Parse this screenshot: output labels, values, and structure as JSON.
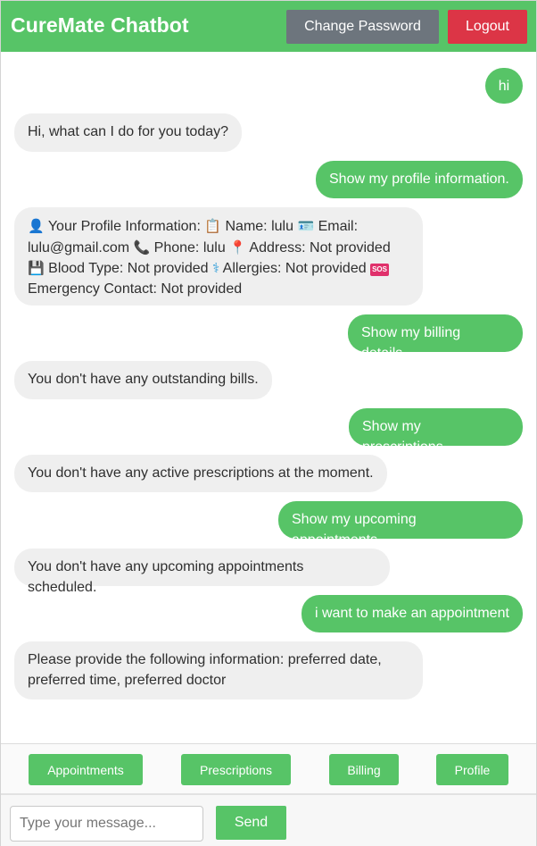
{
  "app": {
    "title": "CureMate Chatbot",
    "change_password_label": "Change Password",
    "logout_label": "Logout"
  },
  "messages": [
    {
      "role": "user",
      "text": "hi"
    },
    {
      "role": "bot",
      "text": "Hi, what can I do for you today?"
    },
    {
      "role": "user",
      "text": "Show my profile information."
    },
    {
      "role": "bot",
      "profile": {
        "line1_a": "Your Profile Information:",
        "line1_b": "Name: lulu",
        "line1_c": "Email:",
        "line2_a": "lulu@gmail.com",
        "line2_b": "Phone: lulu",
        "line2_c": "Address: Not provided",
        "line3_a": "Blood Type: Not provided",
        "line3_b": "Allergies: Not provided",
        "line4": "Emergency Contact: Not provided"
      }
    },
    {
      "role": "user",
      "text": "Show my billing details."
    },
    {
      "role": "bot",
      "text": "You don't have any outstanding bills."
    },
    {
      "role": "user",
      "text": "Show my prescriptions."
    },
    {
      "role": "bot",
      "text": "You don't have any active prescriptions at the moment."
    },
    {
      "role": "user",
      "text": "Show my upcoming appointments."
    },
    {
      "role": "bot",
      "text": "You don't have any upcoming appointments scheduled."
    },
    {
      "role": "user",
      "text": "i want to make an appointment"
    },
    {
      "role": "bot",
      "text": "Please provide the following information: preferred date, preferred time, preferred doctor"
    }
  ],
  "quick_actions": [
    "Appointments",
    "Prescriptions",
    "Billing",
    "Profile"
  ],
  "input": {
    "placeholder": "Type your message...",
    "send_label": "Send"
  },
  "icons": {
    "profile": "bust-silhouette-icon",
    "name": "clipboard-icon",
    "email": "id-card-icon",
    "phone": "telephone-icon",
    "address": "pushpin-icon",
    "blood_type": "floppy-disk-icon",
    "allergies": "medical-symbol-icon",
    "emergency": "sos-icon"
  },
  "colors": {
    "brand": "#57c467",
    "change_password": "#6d757d",
    "logout": "#dc3546",
    "bot_bubble": "#efefef"
  }
}
